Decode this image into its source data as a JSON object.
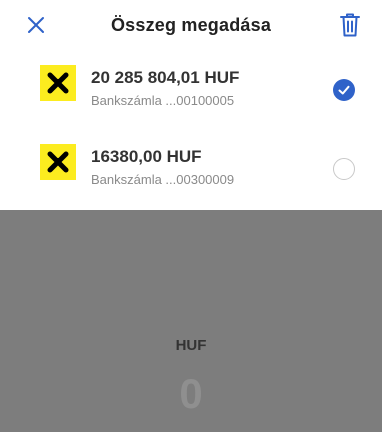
{
  "header": {
    "title": "Összeg megadása",
    "close_icon": "close-icon",
    "trash_icon": "trash-icon"
  },
  "accounts": [
    {
      "amount": "20 285 804,01 HUF",
      "label": "Bankszámla ...00100005",
      "selected": true,
      "logo": "raiffeisen-logo-icon"
    },
    {
      "amount": "16380,00 HUF",
      "label": "Bankszámla ...00300009",
      "selected": false,
      "logo": "raiffeisen-logo-icon"
    }
  ],
  "amount_input": {
    "currency": "HUF",
    "value": "0"
  },
  "colors": {
    "accent": "#2f62c9",
    "logo_yellow": "#fcec1f",
    "input_bg": "#7d7d7d"
  }
}
